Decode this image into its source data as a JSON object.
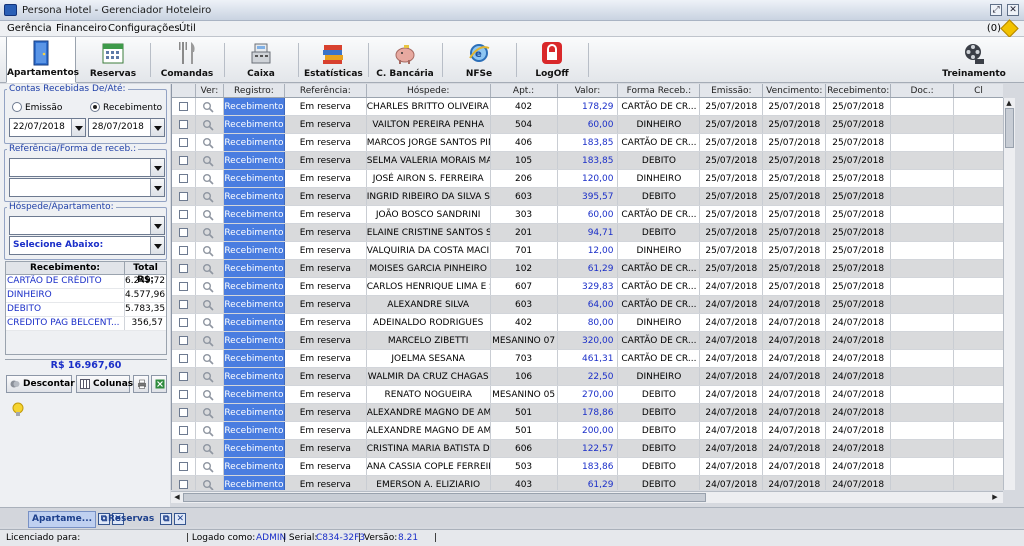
{
  "window": {
    "title": "Persona Hotel - Gerenciador Hoteleiro"
  },
  "menu": {
    "items": [
      "Gerência",
      "Financeiro",
      "Configurações",
      "Útil"
    ],
    "notification_count": "(0)"
  },
  "toolbar": {
    "buttons": [
      {
        "label": "Apartamentos",
        "icon": "door-icon"
      },
      {
        "label": "Reservas",
        "icon": "calendar-icon"
      },
      {
        "label": "Comandas",
        "icon": "cutlery-icon"
      },
      {
        "label": "Caixa",
        "icon": "cash-register-icon"
      },
      {
        "label": "Estatísticas",
        "icon": "books-icon"
      },
      {
        "label": "C. Bancária",
        "icon": "piggy-bank-icon"
      },
      {
        "label": "NFSe",
        "icon": "ie-globe-icon"
      },
      {
        "label": "LogOff",
        "icon": "lock-icon"
      },
      {
        "label": "Treinamento",
        "icon": "film-reel-icon"
      }
    ]
  },
  "filters": {
    "contas_legend": "Contas Recebidas De/Até:",
    "radio_emissao": "Emissão",
    "radio_recebimento": "Recebimento",
    "date_from": "22/07/2018",
    "date_to": "28/07/2018",
    "referencia_legend": "Referência/Forma de receb.:",
    "referencia_value": "",
    "forma_value": "",
    "hospede_legend": "Hóspede/Apartamento:",
    "hospede_value": "",
    "apartamento_value": "Selecione Abaixo:"
  },
  "summary": {
    "headers": [
      "Recebimento:",
      "Total R$:"
    ],
    "rows": [
      {
        "label": "CARTÃO DE CRÉDITO",
        "value": "6.249,72"
      },
      {
        "label": "DINHEIRO",
        "value": "4.577,96"
      },
      {
        "label": "DEBITO",
        "value": "5.783,35"
      },
      {
        "label": "CREDITO PAG BELCENT...",
        "value": "356,57"
      }
    ],
    "total": "R$ 16.967,60"
  },
  "left_buttons": {
    "descontar": "Descontar",
    "colunas": "Colunas"
  },
  "grid": {
    "headers": [
      "",
      "Ver:",
      "Registro:",
      "Referência:",
      "Hóspede:",
      "Apt.:",
      "Valor:",
      "Forma Receb.:",
      "Emissão:",
      "Vencimento:",
      "Recebimento:",
      "Doc.:",
      "Cl"
    ],
    "rows": [
      [
        "Recebimento",
        "Em reserva",
        "CHARLES BRITTO OLIVEIRA GOM...",
        "402",
        "178,29",
        "CARTÃO DE CR...",
        "25/07/2018",
        "25/07/2018",
        "25/07/2018"
      ],
      [
        "Recebimento",
        "Em reserva",
        "VAILTON PEREIRA PENHA",
        "504",
        "60,00",
        "DINHEIRO",
        "25/07/2018",
        "25/07/2018",
        "25/07/2018"
      ],
      [
        "Recebimento",
        "Em reserva",
        "MARCOS JORGE SANTOS PINTO",
        "406",
        "183,85",
        "CARTÃO DE CR...",
        "25/07/2018",
        "25/07/2018",
        "25/07/2018"
      ],
      [
        "Recebimento",
        "Em reserva",
        "SELMA VALERIA MORAIS MAGALH...",
        "105",
        "183,85",
        "DEBITO",
        "25/07/2018",
        "25/07/2018",
        "25/07/2018"
      ],
      [
        "Recebimento",
        "Em reserva",
        "JOSÉ AIRON S. FERREIRA",
        "206",
        "120,00",
        "DINHEIRO",
        "25/07/2018",
        "25/07/2018",
        "25/07/2018"
      ],
      [
        "Recebimento",
        "Em reserva",
        "INGRID RIBEIRO DA SILVA SOUSA",
        "603",
        "395,57",
        "DEBITO",
        "25/07/2018",
        "25/07/2018",
        "25/07/2018"
      ],
      [
        "Recebimento",
        "Em reserva",
        "JOÃO BOSCO SANDRINI",
        "303",
        "60,00",
        "CARTÃO DE CR...",
        "25/07/2018",
        "25/07/2018",
        "25/07/2018"
      ],
      [
        "Recebimento",
        "Em reserva",
        "ELAINE CRISTINE SANTOS SERE...",
        "201",
        "94,71",
        "DEBITO",
        "25/07/2018",
        "25/07/2018",
        "25/07/2018"
      ],
      [
        "Recebimento",
        "Em reserva",
        "VALQUIRIA DA COSTA MACIEL",
        "701",
        "12,00",
        "DINHEIRO",
        "25/07/2018",
        "25/07/2018",
        "25/07/2018"
      ],
      [
        "Recebimento",
        "Em reserva",
        "MOISES GARCIA PINHEIRO",
        "102",
        "61,29",
        "CARTÃO DE CR...",
        "25/07/2018",
        "25/07/2018",
        "25/07/2018"
      ],
      [
        "Recebimento",
        "Em reserva",
        "CARLOS HENRIQUE LIMA E SILVA",
        "607",
        "329,83",
        "CARTÃO DE CR...",
        "24/07/2018",
        "25/07/2018",
        "25/07/2018"
      ],
      [
        "Recebimento",
        "Em reserva",
        "ALEXANDRE SILVA",
        "603",
        "64,00",
        "CARTÃO DE CR...",
        "24/07/2018",
        "24/07/2018",
        "25/07/2018"
      ],
      [
        "Recebimento",
        "Em reserva",
        "ADEINALDO RODRIGUES",
        "402",
        "80,00",
        "DINHEIRO",
        "24/07/2018",
        "24/07/2018",
        "24/07/2018"
      ],
      [
        "Recebimento",
        "Em reserva",
        "MARCELO ZIBETTI",
        "MESANINO 07",
        "320,00",
        "CARTÃO DE CR...",
        "24/07/2018",
        "24/07/2018",
        "24/07/2018"
      ],
      [
        "Recebimento",
        "Em reserva",
        "JOELMA SESANA",
        "703",
        "461,31",
        "CARTÃO DE CR...",
        "24/07/2018",
        "24/07/2018",
        "24/07/2018"
      ],
      [
        "Recebimento",
        "Em reserva",
        "WALMIR DA CRUZ CHAGAS",
        "106",
        "22,50",
        "DINHEIRO",
        "24/07/2018",
        "24/07/2018",
        "24/07/2018"
      ],
      [
        "Recebimento",
        "Em reserva",
        "RENATO NOGUEIRA",
        "MESANINO 05",
        "270,00",
        "DEBITO",
        "24/07/2018",
        "24/07/2018",
        "24/07/2018"
      ],
      [
        "Recebimento",
        "Em reserva",
        "ALEXANDRE MAGNO DE AMORIM",
        "501",
        "178,86",
        "DEBITO",
        "24/07/2018",
        "24/07/2018",
        "24/07/2018"
      ],
      [
        "Recebimento",
        "Em reserva",
        "ALEXANDRE MAGNO DE AMORIM",
        "501",
        "200,00",
        "DEBITO",
        "24/07/2018",
        "24/07/2018",
        "24/07/2018"
      ],
      [
        "Recebimento",
        "Em reserva",
        "CRISTINA MARIA BATISTA DE LAC...",
        "606",
        "122,57",
        "DEBITO",
        "24/07/2018",
        "24/07/2018",
        "24/07/2018"
      ],
      [
        "Recebimento",
        "Em reserva",
        "ANA CASSIA COPLE FERREIRA",
        "503",
        "183,86",
        "DEBITO",
        "24/07/2018",
        "24/07/2018",
        "24/07/2018"
      ],
      [
        "Recebimento",
        "Em reserva",
        "EMERSON A. ELIZIARIO",
        "403",
        "61,29",
        "DEBITO",
        "24/07/2018",
        "24/07/2018",
        "24/07/2018"
      ]
    ]
  },
  "taskbar": {
    "tabs": [
      "Apartame...",
      "Reservas"
    ]
  },
  "status": {
    "licenciado": "Licenciado para:",
    "logado_label": "| Logado como:",
    "user": "ADMIN",
    "serial_label": "| Serial:",
    "serial": "C834-32F3",
    "versao_label": "| Versão:",
    "versao": "8.21",
    "end": "|"
  },
  "colors": {
    "accent": "#1a2ec8",
    "registro_cell": "#4a7de0",
    "row_alt": "#d9dadc"
  }
}
